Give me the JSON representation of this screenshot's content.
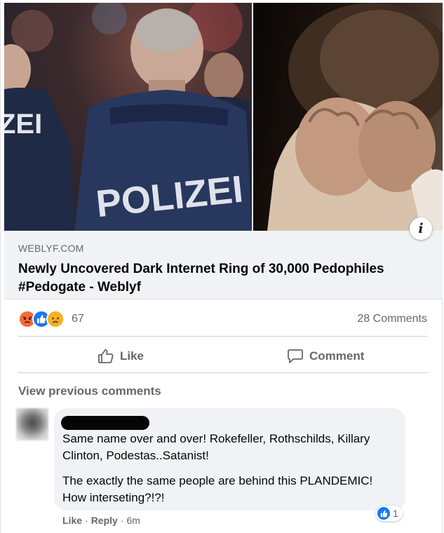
{
  "link_preview": {
    "domain": "WEBLYF.COM",
    "headline": "Newly Uncovered Dark Internet Ring of 30,000 Pedophiles #Pedogate - Weblyf",
    "image_left_text": "POLIZEI",
    "image_left_edge_text": "ZEI",
    "info_icon": "info-icon"
  },
  "engagement": {
    "reaction_icons": [
      "angry-reaction-icon",
      "like-reaction-icon",
      "sad-reaction-icon"
    ],
    "reaction_count": "67",
    "comments_count": "28 Comments"
  },
  "actions": {
    "like_label": "Like",
    "comment_label": "Comment"
  },
  "comments": {
    "view_previous": "View previous comments",
    "items": [
      {
        "author_redacted": true,
        "paragraphs": [
          "Same name over and over! Rokefeller, Rothschilds, Killary Clinton, Podestas..Satanist!",
          "The exactly the same people are behind this PLANDEMIC! How interseting?!?!"
        ],
        "reaction_count": "1",
        "like_label": "Like",
        "separator": "·",
        "reply_label": "Reply",
        "time": "6m"
      }
    ]
  },
  "colors": {
    "meta_gray": "#65676b",
    "bubble_bg": "#f0f2f5",
    "like_blue": "#1877f2",
    "angry_orange": "#f25268",
    "sad_yellow": "#f7b125"
  }
}
